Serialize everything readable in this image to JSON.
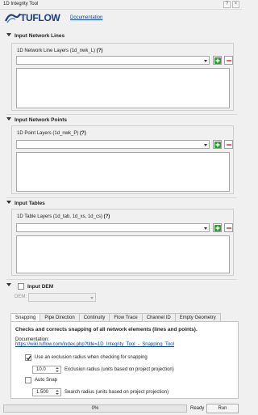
{
  "window": {
    "title": "1D Integrity Tool",
    "help_glyph": "?",
    "close_glyph": "×"
  },
  "header": {
    "logo_text": "TUFLOW",
    "documentation_link": "Documentation"
  },
  "sections": {
    "lines": {
      "header": "Input Network Lines",
      "label": "1D Network Line Layers (1d_nwk_L)",
      "help": "(?)"
    },
    "points": {
      "header": "Input Network Points",
      "label": "1D Point Layers (1d_nwk_P)",
      "help": "(?)"
    },
    "tables": {
      "header": "Input Tables",
      "label": "1D Table Layers (1d_tab, 1d_xs, 1d_cs)",
      "help": "(?)"
    }
  },
  "dem": {
    "checkbox_label": "Input DEM",
    "sub_label": "DEM:"
  },
  "tabs": [
    {
      "label": "Snapping",
      "active": true
    },
    {
      "label": "Pipe Direction",
      "active": false
    },
    {
      "label": "Continuity",
      "active": false
    },
    {
      "label": "Flow Trace",
      "active": false
    },
    {
      "label": "Channel ID",
      "active": false
    },
    {
      "label": "Empty Geometry",
      "active": false
    }
  ],
  "snapping": {
    "title": "Checks and corrects snapping of all network elements (lines and points).",
    "doc_label": "Documentation:",
    "doc_url": "https://wiki.tuflow.com/index.php?title=1D_Integrity_Tool_-_Snapping_Tool",
    "use_exclusion_label": "Use an exclusion radius when checking for snapping",
    "use_exclusion_checked": true,
    "exclusion_value": "10.0",
    "exclusion_label": "Exclusion radius (units based on project projection)",
    "auto_snap_label": "Auto Snap",
    "auto_snap_checked": false,
    "search_value": "1.500",
    "search_label": "Search radius (units based on project projection)"
  },
  "footer": {
    "progress_text": "0%",
    "progress_value": 0,
    "status": "Ready",
    "run_button": "Run"
  },
  "colors": {
    "add_button": "#3a9a3a",
    "remove_button": "#e53935",
    "link": "#0645ad",
    "logo": "#1d3e7d"
  }
}
